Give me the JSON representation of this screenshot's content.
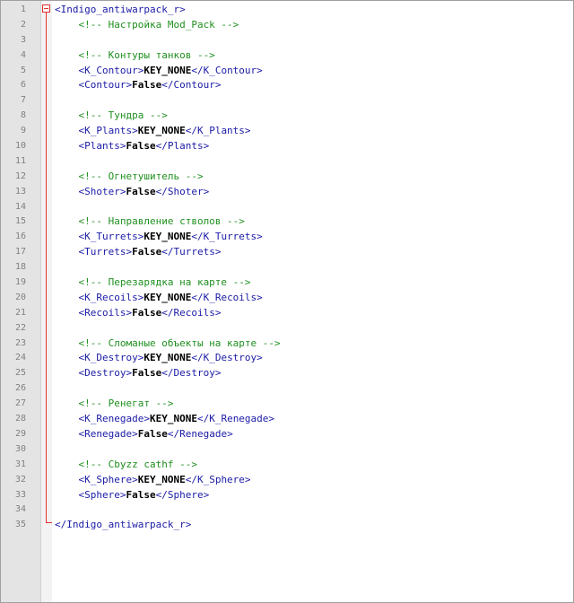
{
  "editor": {
    "lines": [
      {
        "n": "1",
        "parts": [
          {
            "t": "tag",
            "s": "<Indigo_antiwarpack_r>"
          }
        ]
      },
      {
        "n": "2",
        "parts": [
          {
            "t": "cmt",
            "s": "    <!-- Настройка Mod_Pack -->"
          }
        ]
      },
      {
        "n": "3",
        "parts": []
      },
      {
        "n": "4",
        "parts": [
          {
            "t": "cmt",
            "s": "    <!-- Контуры танков -->"
          }
        ]
      },
      {
        "n": "5",
        "parts": [
          {
            "t": "tag",
            "s": "    <K_Contour>"
          },
          {
            "t": "val",
            "s": "KEY_NONE"
          },
          {
            "t": "tag",
            "s": "</K_Contour>"
          }
        ]
      },
      {
        "n": "6",
        "parts": [
          {
            "t": "tag",
            "s": "    <Contour>"
          },
          {
            "t": "val",
            "s": "False"
          },
          {
            "t": "tag",
            "s": "</Contour>"
          }
        ]
      },
      {
        "n": "7",
        "parts": []
      },
      {
        "n": "8",
        "parts": [
          {
            "t": "cmt",
            "s": "    <!-- Тундра -->"
          }
        ]
      },
      {
        "n": "9",
        "parts": [
          {
            "t": "tag",
            "s": "    <K_Plants>"
          },
          {
            "t": "val",
            "s": "KEY_NONE"
          },
          {
            "t": "tag",
            "s": "</K_Plants>"
          }
        ]
      },
      {
        "n": "10",
        "parts": [
          {
            "t": "tag",
            "s": "    <Plants>"
          },
          {
            "t": "val",
            "s": "False"
          },
          {
            "t": "tag",
            "s": "</Plants>"
          }
        ]
      },
      {
        "n": "11",
        "parts": []
      },
      {
        "n": "12",
        "parts": [
          {
            "t": "cmt",
            "s": "    <!-- Огнетушитель -->"
          }
        ]
      },
      {
        "n": "13",
        "parts": [
          {
            "t": "tag",
            "s": "    <Shoter>"
          },
          {
            "t": "val",
            "s": "False"
          },
          {
            "t": "tag",
            "s": "</Shoter>"
          }
        ]
      },
      {
        "n": "14",
        "parts": []
      },
      {
        "n": "15",
        "parts": [
          {
            "t": "cmt",
            "s": "    <!-- Направление стволов -->"
          }
        ]
      },
      {
        "n": "16",
        "parts": [
          {
            "t": "tag",
            "s": "    <K_Turrets>"
          },
          {
            "t": "val",
            "s": "KEY_NONE"
          },
          {
            "t": "tag",
            "s": "</K_Turrets>"
          }
        ]
      },
      {
        "n": "17",
        "parts": [
          {
            "t": "tag",
            "s": "    <Turrets>"
          },
          {
            "t": "val",
            "s": "False"
          },
          {
            "t": "tag",
            "s": "</Turrets>"
          }
        ]
      },
      {
        "n": "18",
        "parts": []
      },
      {
        "n": "19",
        "parts": [
          {
            "t": "cmt",
            "s": "    <!-- Перезарядка на карте -->"
          }
        ]
      },
      {
        "n": "20",
        "parts": [
          {
            "t": "tag",
            "s": "    <K_Recoils>"
          },
          {
            "t": "val",
            "s": "KEY_NONE"
          },
          {
            "t": "tag",
            "s": "</K_Recoils>"
          }
        ]
      },
      {
        "n": "21",
        "parts": [
          {
            "t": "tag",
            "s": "    <Recoils>"
          },
          {
            "t": "val",
            "s": "False"
          },
          {
            "t": "tag",
            "s": "</Recoils>"
          }
        ]
      },
      {
        "n": "22",
        "parts": []
      },
      {
        "n": "23",
        "parts": [
          {
            "t": "cmt",
            "s": "    <!-- Сломаные объекты на карте -->"
          }
        ]
      },
      {
        "n": "24",
        "parts": [
          {
            "t": "tag",
            "s": "    <K_Destroy>"
          },
          {
            "t": "val",
            "s": "KEY_NONE"
          },
          {
            "t": "tag",
            "s": "</K_Destroy>"
          }
        ]
      },
      {
        "n": "25",
        "parts": [
          {
            "t": "tag",
            "s": "    <Destroy>"
          },
          {
            "t": "val",
            "s": "False"
          },
          {
            "t": "tag",
            "s": "</Destroy>"
          }
        ]
      },
      {
        "n": "26",
        "parts": []
      },
      {
        "n": "27",
        "parts": [
          {
            "t": "cmt",
            "s": "    <!-- Ренегат -->"
          }
        ]
      },
      {
        "n": "28",
        "parts": [
          {
            "t": "tag",
            "s": "    <K_Renegade>"
          },
          {
            "t": "val",
            "s": "KEY_NONE"
          },
          {
            "t": "tag",
            "s": "</K_Renegade>"
          }
        ]
      },
      {
        "n": "29",
        "parts": [
          {
            "t": "tag",
            "s": "    <Renegade>"
          },
          {
            "t": "val",
            "s": "False"
          },
          {
            "t": "tag",
            "s": "</Renegade>"
          }
        ]
      },
      {
        "n": "30",
        "parts": []
      },
      {
        "n": "31",
        "parts": [
          {
            "t": "cmt",
            "s": "    <!-- Cbyzz cathf -->"
          }
        ]
      },
      {
        "n": "32",
        "parts": [
          {
            "t": "tag",
            "s": "    <K_Sphere>"
          },
          {
            "t": "val",
            "s": "KEY_NONE"
          },
          {
            "t": "tag",
            "s": "</K_Sphere>"
          }
        ]
      },
      {
        "n": "33",
        "parts": [
          {
            "t": "tag",
            "s": "    <Sphere>"
          },
          {
            "t": "val",
            "s": "False"
          },
          {
            "t": "tag",
            "s": "</Sphere>"
          }
        ]
      },
      {
        "n": "34",
        "parts": []
      },
      {
        "n": "35",
        "parts": [
          {
            "t": "tag",
            "s": "</Indigo_antiwarpack_r>"
          }
        ]
      }
    ],
    "colors": {
      "tag": "#1a1aa6",
      "value": "#000000",
      "comment": "#1f8f1f",
      "fold": "#e03030"
    }
  }
}
